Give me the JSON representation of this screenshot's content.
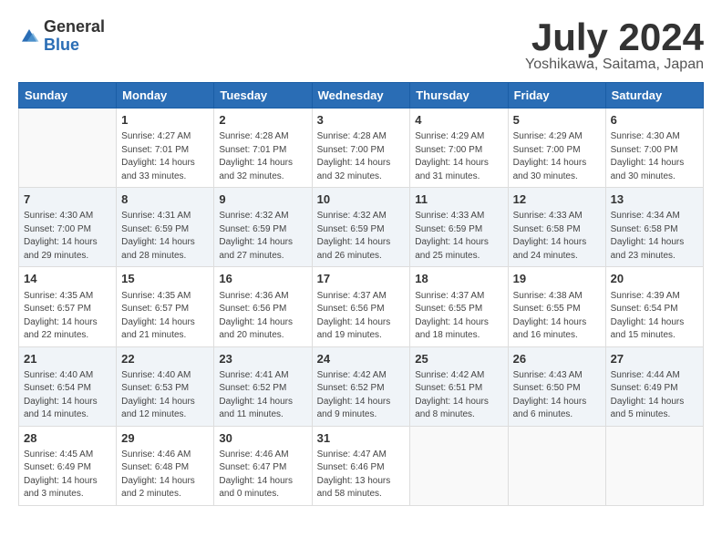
{
  "header": {
    "logo_general": "General",
    "logo_blue": "Blue",
    "title": "July 2024",
    "location": "Yoshikawa, Saitama, Japan"
  },
  "weekdays": [
    "Sunday",
    "Monday",
    "Tuesday",
    "Wednesday",
    "Thursday",
    "Friday",
    "Saturday"
  ],
  "weeks": [
    [
      {
        "day": "",
        "info": ""
      },
      {
        "day": "1",
        "info": "Sunrise: 4:27 AM\nSunset: 7:01 PM\nDaylight: 14 hours\nand 33 minutes."
      },
      {
        "day": "2",
        "info": "Sunrise: 4:28 AM\nSunset: 7:01 PM\nDaylight: 14 hours\nand 32 minutes."
      },
      {
        "day": "3",
        "info": "Sunrise: 4:28 AM\nSunset: 7:00 PM\nDaylight: 14 hours\nand 32 minutes."
      },
      {
        "day": "4",
        "info": "Sunrise: 4:29 AM\nSunset: 7:00 PM\nDaylight: 14 hours\nand 31 minutes."
      },
      {
        "day": "5",
        "info": "Sunrise: 4:29 AM\nSunset: 7:00 PM\nDaylight: 14 hours\nand 30 minutes."
      },
      {
        "day": "6",
        "info": "Sunrise: 4:30 AM\nSunset: 7:00 PM\nDaylight: 14 hours\nand 30 minutes."
      }
    ],
    [
      {
        "day": "7",
        "info": "Sunrise: 4:30 AM\nSunset: 7:00 PM\nDaylight: 14 hours\nand 29 minutes."
      },
      {
        "day": "8",
        "info": "Sunrise: 4:31 AM\nSunset: 6:59 PM\nDaylight: 14 hours\nand 28 minutes."
      },
      {
        "day": "9",
        "info": "Sunrise: 4:32 AM\nSunset: 6:59 PM\nDaylight: 14 hours\nand 27 minutes."
      },
      {
        "day": "10",
        "info": "Sunrise: 4:32 AM\nSunset: 6:59 PM\nDaylight: 14 hours\nand 26 minutes."
      },
      {
        "day": "11",
        "info": "Sunrise: 4:33 AM\nSunset: 6:59 PM\nDaylight: 14 hours\nand 25 minutes."
      },
      {
        "day": "12",
        "info": "Sunrise: 4:33 AM\nSunset: 6:58 PM\nDaylight: 14 hours\nand 24 minutes."
      },
      {
        "day": "13",
        "info": "Sunrise: 4:34 AM\nSunset: 6:58 PM\nDaylight: 14 hours\nand 23 minutes."
      }
    ],
    [
      {
        "day": "14",
        "info": "Sunrise: 4:35 AM\nSunset: 6:57 PM\nDaylight: 14 hours\nand 22 minutes."
      },
      {
        "day": "15",
        "info": "Sunrise: 4:35 AM\nSunset: 6:57 PM\nDaylight: 14 hours\nand 21 minutes."
      },
      {
        "day": "16",
        "info": "Sunrise: 4:36 AM\nSunset: 6:56 PM\nDaylight: 14 hours\nand 20 minutes."
      },
      {
        "day": "17",
        "info": "Sunrise: 4:37 AM\nSunset: 6:56 PM\nDaylight: 14 hours\nand 19 minutes."
      },
      {
        "day": "18",
        "info": "Sunrise: 4:37 AM\nSunset: 6:55 PM\nDaylight: 14 hours\nand 18 minutes."
      },
      {
        "day": "19",
        "info": "Sunrise: 4:38 AM\nSunset: 6:55 PM\nDaylight: 14 hours\nand 16 minutes."
      },
      {
        "day": "20",
        "info": "Sunrise: 4:39 AM\nSunset: 6:54 PM\nDaylight: 14 hours\nand 15 minutes."
      }
    ],
    [
      {
        "day": "21",
        "info": "Sunrise: 4:40 AM\nSunset: 6:54 PM\nDaylight: 14 hours\nand 14 minutes."
      },
      {
        "day": "22",
        "info": "Sunrise: 4:40 AM\nSunset: 6:53 PM\nDaylight: 14 hours\nand 12 minutes."
      },
      {
        "day": "23",
        "info": "Sunrise: 4:41 AM\nSunset: 6:52 PM\nDaylight: 14 hours\nand 11 minutes."
      },
      {
        "day": "24",
        "info": "Sunrise: 4:42 AM\nSunset: 6:52 PM\nDaylight: 14 hours\nand 9 minutes."
      },
      {
        "day": "25",
        "info": "Sunrise: 4:42 AM\nSunset: 6:51 PM\nDaylight: 14 hours\nand 8 minutes."
      },
      {
        "day": "26",
        "info": "Sunrise: 4:43 AM\nSunset: 6:50 PM\nDaylight: 14 hours\nand 6 minutes."
      },
      {
        "day": "27",
        "info": "Sunrise: 4:44 AM\nSunset: 6:49 PM\nDaylight: 14 hours\nand 5 minutes."
      }
    ],
    [
      {
        "day": "28",
        "info": "Sunrise: 4:45 AM\nSunset: 6:49 PM\nDaylight: 14 hours\nand 3 minutes."
      },
      {
        "day": "29",
        "info": "Sunrise: 4:46 AM\nSunset: 6:48 PM\nDaylight: 14 hours\nand 2 minutes."
      },
      {
        "day": "30",
        "info": "Sunrise: 4:46 AM\nSunset: 6:47 PM\nDaylight: 14 hours\nand 0 minutes."
      },
      {
        "day": "31",
        "info": "Sunrise: 4:47 AM\nSunset: 6:46 PM\nDaylight: 13 hours\nand 58 minutes."
      },
      {
        "day": "",
        "info": ""
      },
      {
        "day": "",
        "info": ""
      },
      {
        "day": "",
        "info": ""
      }
    ]
  ]
}
